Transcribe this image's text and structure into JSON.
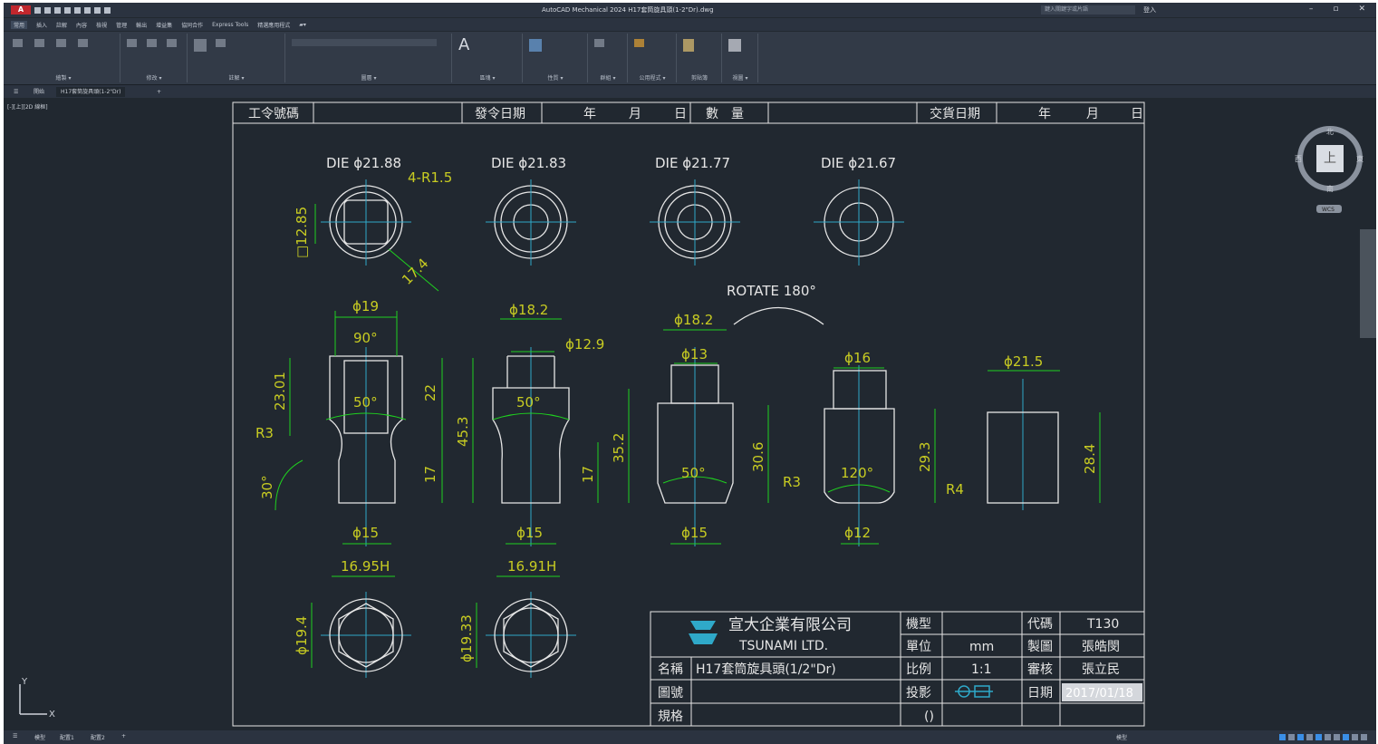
{
  "app": {
    "logo": "A",
    "window_title": "AutoCAD Mechanical 2024   H17套筒旋具頭(1-2\"Dr).dwg",
    "search_placeholder": "鍵入關鍵字或片語",
    "user": "登入",
    "minimize": "–",
    "restore": "▫",
    "close": "✕"
  },
  "menu": [
    "常用",
    "插入",
    "註解",
    "內容",
    "檢視",
    "管理",
    "輸出",
    "增益集",
    "協同合作",
    "Express Tools",
    "精選應用程式",
    "▰▾"
  ],
  "ribbon_panels": [
    "繪製 ▾",
    "修改 ▾",
    "註解 ▾",
    "圖層 ▾",
    "區塊 ▾",
    "性質 ▾",
    "群組 ▾",
    "公用程式 ▾",
    "剪貼簿",
    "視圖 ▾"
  ],
  "ribbon_big_label": "A",
  "doc_tabs": {
    "menu": "☰",
    "start": "開始",
    "drawing": "H17套筒旋具頭(1-2\"Dr)",
    "add": "+"
  },
  "viewport_label": "[-][上][2D 線框]",
  "viewcube": {
    "face": "上",
    "north": "北",
    "south": "南",
    "east": "東",
    "west": "西",
    "wcs": "WCS"
  },
  "ucs": {
    "x": "X",
    "y": "Y"
  },
  "status": {
    "grid": "☰",
    "tabs": [
      "模型",
      "配置1",
      "配置2"
    ],
    "add": "+",
    "mode": "模型"
  },
  "header_row": {
    "work_no": "工令號碼",
    "issue_date": "發令日期",
    "year1": "年",
    "month1": "月",
    "day1": "日",
    "quantity": "數　量",
    "delivery_date": "交貨日期",
    "year2": "年",
    "month2": "月",
    "day2": "日"
  },
  "drawing": {
    "dies": [
      "DIE ϕ21.88",
      "DIE ϕ21.83",
      "DIE ϕ21.77",
      "DIE ϕ21.67"
    ],
    "r15": "4-R1.5",
    "sq": "□12.85",
    "d174": "17.4",
    "rotate": "ROTATE 180°",
    "p1": {
      "top": "ϕ19",
      "ang": "90°",
      "a50": "50°",
      "h1": "23.01",
      "h2": "22",
      "h3": "45.3",
      "h4": "17",
      "r": "R3",
      "a30": "30°",
      "bot": "ϕ15"
    },
    "p2": {
      "top": "ϕ18.2",
      "inner": "ϕ12.9",
      "a50": "50°",
      "h1": "17",
      "h2": "35.2",
      "bot": "ϕ15"
    },
    "p3": {
      "top": "ϕ18.2",
      "inner": "ϕ13",
      "a50": "50°",
      "h1": "30.6",
      "r": "R3",
      "bot": "ϕ15"
    },
    "p4": {
      "top": "ϕ16",
      "a120": "120°",
      "h1": "29.3",
      "r": "R4",
      "bot": "ϕ12"
    },
    "p5": {
      "top": "ϕ21.5",
      "h1": "28.4"
    },
    "hex1": {
      "w": "16.95H",
      "d": "ϕ19.4"
    },
    "hex2": {
      "w": "16.91H",
      "d": "ϕ19.33"
    }
  },
  "title_block": {
    "company_cn": "宣大企業有限公司",
    "company_en": "TSUNAMI LTD.",
    "model_label": "機型",
    "model_value": "",
    "code_label": "代碼",
    "code_value": "T130",
    "unit_label": "單位",
    "unit_value": "mm",
    "drawn_label": "製圖",
    "drawn_value": "張皓閔",
    "name_label": "名稱",
    "name_value": "H17套筒旋具頭(1/2\"Dr)",
    "scale_label": "比例",
    "scale_value": "1:1",
    "check_label": "審核",
    "check_value": "張立民",
    "figno_label": "圖號",
    "proj_label": "投影",
    "date_label": "日期",
    "date_value": "2017/01/18",
    "spec_label": "規格",
    "rev_value": "()"
  },
  "colors": {
    "bg": "#212830",
    "line": "#e8e8e8",
    "dim": "#1fd11f",
    "text": "#c8cc22",
    "center": "#2fa9c9"
  }
}
